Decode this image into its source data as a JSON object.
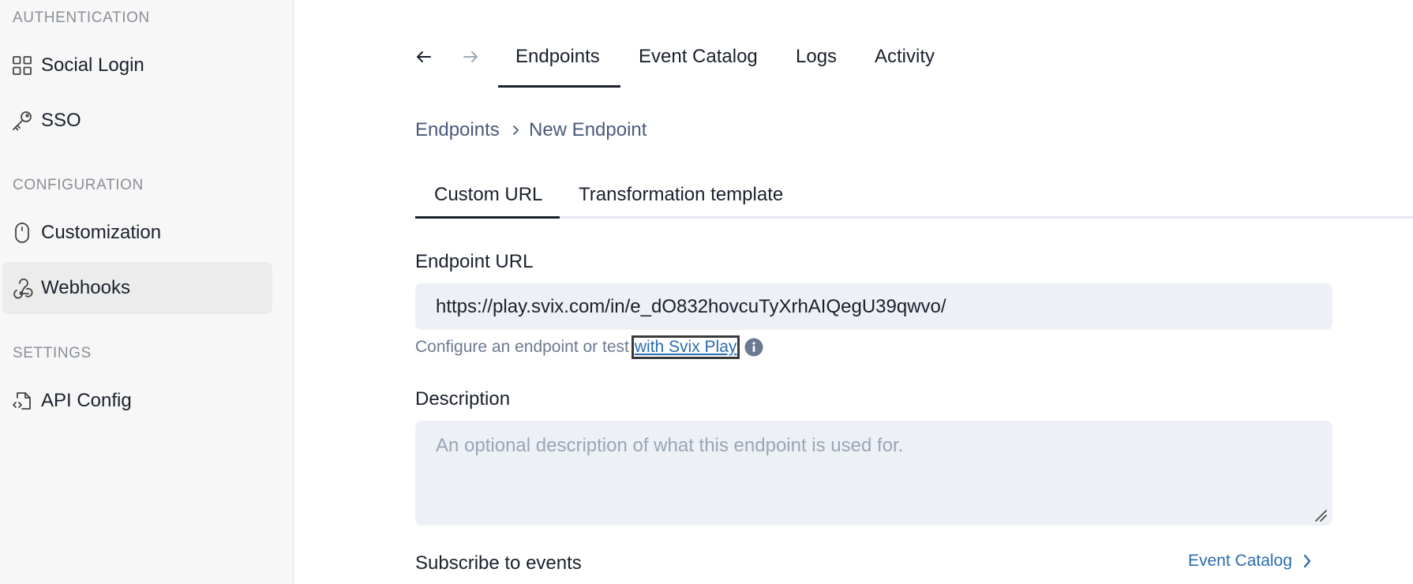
{
  "sidebar": {
    "sections": {
      "authentication": "AUTHENTICATION",
      "configuration": "CONFIGURATION",
      "settings": "SETTINGS"
    },
    "items": [
      {
        "label": "Social Login",
        "icon": "grid-icon",
        "active": false
      },
      {
        "label": "SSO",
        "icon": "key-icon",
        "active": false
      },
      {
        "label": "Customization",
        "icon": "mouse-icon",
        "active": false
      },
      {
        "label": "Webhooks",
        "icon": "webhook-icon",
        "active": true
      },
      {
        "label": "API Config",
        "icon": "file-code-icon",
        "active": false
      }
    ]
  },
  "topnav": {
    "back_icon": "arrow-left-icon",
    "forward_icon": "arrow-right-icon",
    "tabs": [
      {
        "label": "Endpoints",
        "active": true
      },
      {
        "label": "Event Catalog",
        "active": false
      },
      {
        "label": "Logs",
        "active": false
      },
      {
        "label": "Activity",
        "active": false
      }
    ]
  },
  "breadcrumb": {
    "parent": "Endpoints",
    "current": "New Endpoint"
  },
  "subtabs": [
    {
      "label": "Custom URL",
      "active": true
    },
    {
      "label": "Transformation template",
      "active": false
    }
  ],
  "form": {
    "endpoint_url_label": "Endpoint URL",
    "endpoint_url_value": "https://play.svix.com/in/e_dO832hovcuTyXrhAIQegU39qwvo/",
    "help_text": "Configure an endpoint or test",
    "help_link": "with Svix Play",
    "description_label": "Description",
    "description_placeholder": "An optional description of what this endpoint is used for.",
    "subscribe_label": "Subscribe to events",
    "event_catalog_link": "Event Catalog"
  },
  "colors": {
    "link": "#2b6cb0",
    "input_bg": "#edf1f6",
    "sidebar_bg": "#f7f7f7",
    "active_item_bg": "#ececec"
  }
}
